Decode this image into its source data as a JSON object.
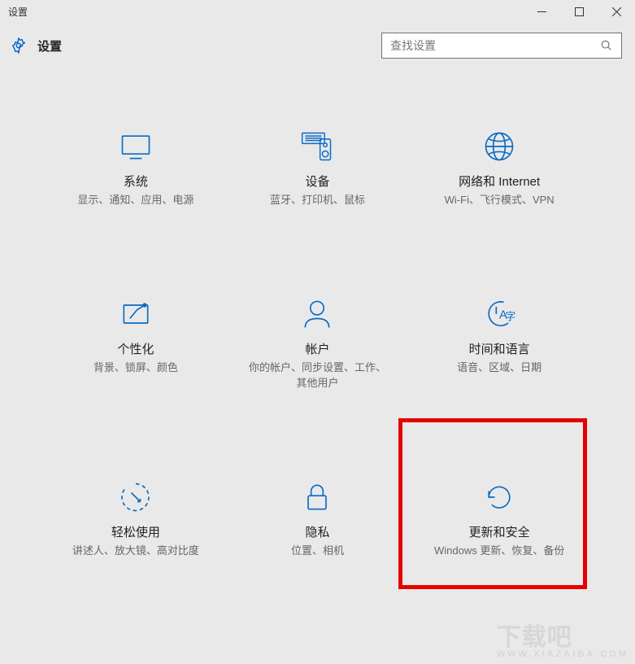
{
  "window": {
    "title": "设置"
  },
  "header": {
    "app_name": "设置",
    "search_placeholder": "查找设置"
  },
  "tiles": {
    "system": {
      "title": "系统",
      "desc": "显示、通知、应用、电源"
    },
    "devices": {
      "title": "设备",
      "desc": "蓝牙、打印机、鼠标"
    },
    "network": {
      "title": "网络和 Internet",
      "desc": "Wi-Fi、飞行模式、VPN"
    },
    "personalize": {
      "title": "个性化",
      "desc": "背景、锁屏、颜色"
    },
    "accounts": {
      "title": "帐户",
      "desc": "你的帐户、同步设置、工作、其他用户"
    },
    "timelang": {
      "title": "时间和语言",
      "desc": "语音、区域、日期"
    },
    "ease": {
      "title": "轻松使用",
      "desc": "讲述人、放大镜、高对比度"
    },
    "privacy": {
      "title": "隐私",
      "desc": "位置、相机"
    },
    "update": {
      "title": "更新和安全",
      "desc": "Windows 更新、恢复、备份"
    }
  },
  "watermark": {
    "main": "下载吧",
    "sub": "WWW.XIAZAIBA.COM"
  }
}
